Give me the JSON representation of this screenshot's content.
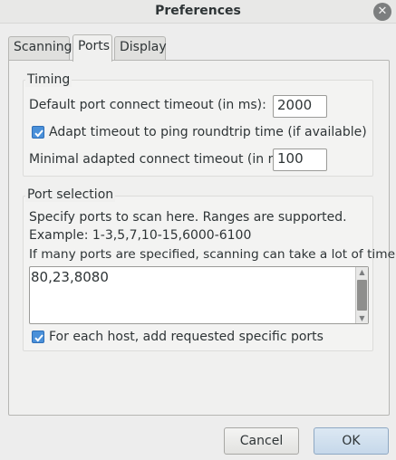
{
  "window": {
    "title": "Preferences",
    "close_glyph": "✕"
  },
  "tabs": [
    {
      "label": "Scanning",
      "active": false
    },
    {
      "label": "Ports",
      "active": true
    },
    {
      "label": "Display",
      "active": false
    }
  ],
  "timing": {
    "title": "Timing",
    "default_timeout_label": "Default port connect timeout (in ms):",
    "default_timeout_value": "2000",
    "adapt_label": "Adapt timeout to ping roundtrip time (if available)",
    "adapt_checked": true,
    "min_timeout_label": "Minimal adapted connect timeout (in ms):",
    "min_timeout_value": "100"
  },
  "port_selection": {
    "title": "Port selection",
    "help_line1": "Specify ports to scan here. Ranges are supported.",
    "help_line2": "Example: 1-3,5,7,10-15,6000-6100",
    "help_line3": "If many ports are specified, scanning can take a lot of time.",
    "ports_value": "80,23,8080",
    "add_specific_label": "For each host, add requested specific ports",
    "add_specific_checked": true,
    "scroll_up_glyph": "▲",
    "scroll_down_glyph": "▼"
  },
  "buttons": {
    "cancel": "Cancel",
    "ok": "OK"
  },
  "colors": {
    "accent": "#4a90d9",
    "background": "#ededed"
  },
  "icons": [
    "close-icon",
    "checkmark-icon",
    "scroll-up-arrow-icon",
    "scroll-down-arrow-icon"
  ]
}
